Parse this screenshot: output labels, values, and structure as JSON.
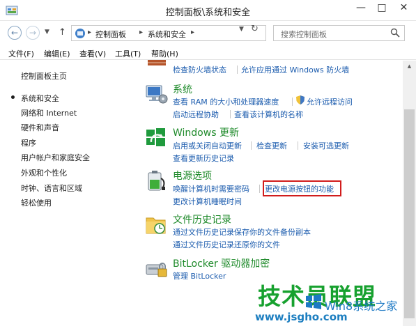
{
  "window": {
    "title": "控制面板\\系统和安全"
  },
  "nav": {
    "breadcrumb": [
      "控制面板",
      "系统和安全"
    ],
    "search_placeholder": "搜索控制面板"
  },
  "menu": [
    "文件(F)",
    "编辑(E)",
    "查看(V)",
    "工具(T)",
    "帮助(H)"
  ],
  "sidebar": {
    "home": "控制面板主页",
    "items": [
      "系统和安全",
      "网络和 Internet",
      "硬件和声音",
      "程序",
      "用户帐户和家庭安全",
      "外观和个性化",
      "时钟、语言和区域",
      "轻松使用"
    ]
  },
  "firewall": {
    "links": [
      "检查防火墙状态",
      "允许应用通过 Windows 防火墙"
    ]
  },
  "system": {
    "title": "系统",
    "links": [
      "查看 RAM 的大小和处理器速度",
      "允许远程访问",
      "启动远程协助",
      "查看该计算机的名称"
    ]
  },
  "windows_update": {
    "title": "Windows 更新",
    "links": [
      "启用或关闭自动更新",
      "检查更新",
      "安装可选更新",
      "查看更新历史记录"
    ]
  },
  "power": {
    "title": "电源选项",
    "links": [
      "唤醒计算机时需要密码",
      "更改电源按钮的功能",
      "更改计算机睡眠时间"
    ]
  },
  "file_history": {
    "title": "文件历史记录",
    "links": [
      "通过文件历史记录保存你的文件备份副本",
      "通过文件历史记录还原你的文件"
    ]
  },
  "bitlocker": {
    "title": "BitLocker 驱动器加密",
    "links": [
      "管理 BitLocker"
    ]
  },
  "watermark": {
    "main": "技术员联盟",
    "sub": "Win8系统之家",
    "url": "www.jsgho.com"
  },
  "colors": {
    "link": "#1c5cae",
    "category_title": "#1e8a2a",
    "highlight_border": "#d11c1c"
  }
}
